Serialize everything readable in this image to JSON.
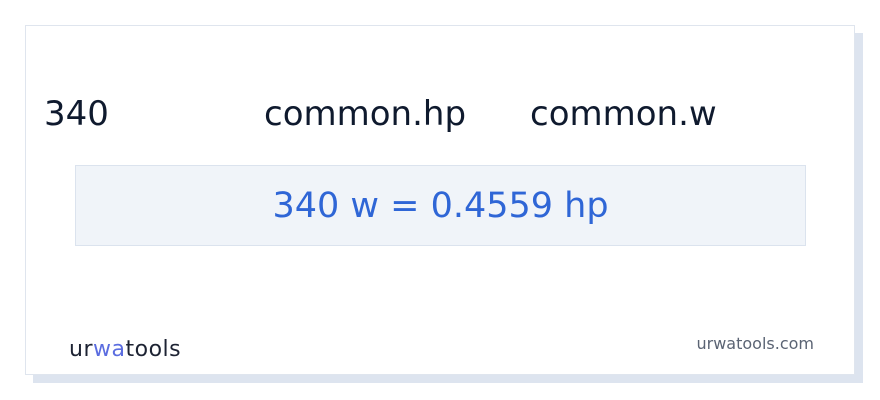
{
  "converter": {
    "value": "340",
    "from_unit": "common.hp",
    "to_unit": "common.w",
    "result": "340 w = 0.4559 hp"
  },
  "footer": {
    "logo_part1": "ur",
    "logo_accent": "wa",
    "logo_part2": "tools",
    "site": "urwatools.com"
  },
  "colors": {
    "result_text": "#2f66d6",
    "result_bg": "#f0f4f9",
    "logo_accent": "#5b6de0",
    "card_shadow": "#dde4ef"
  }
}
